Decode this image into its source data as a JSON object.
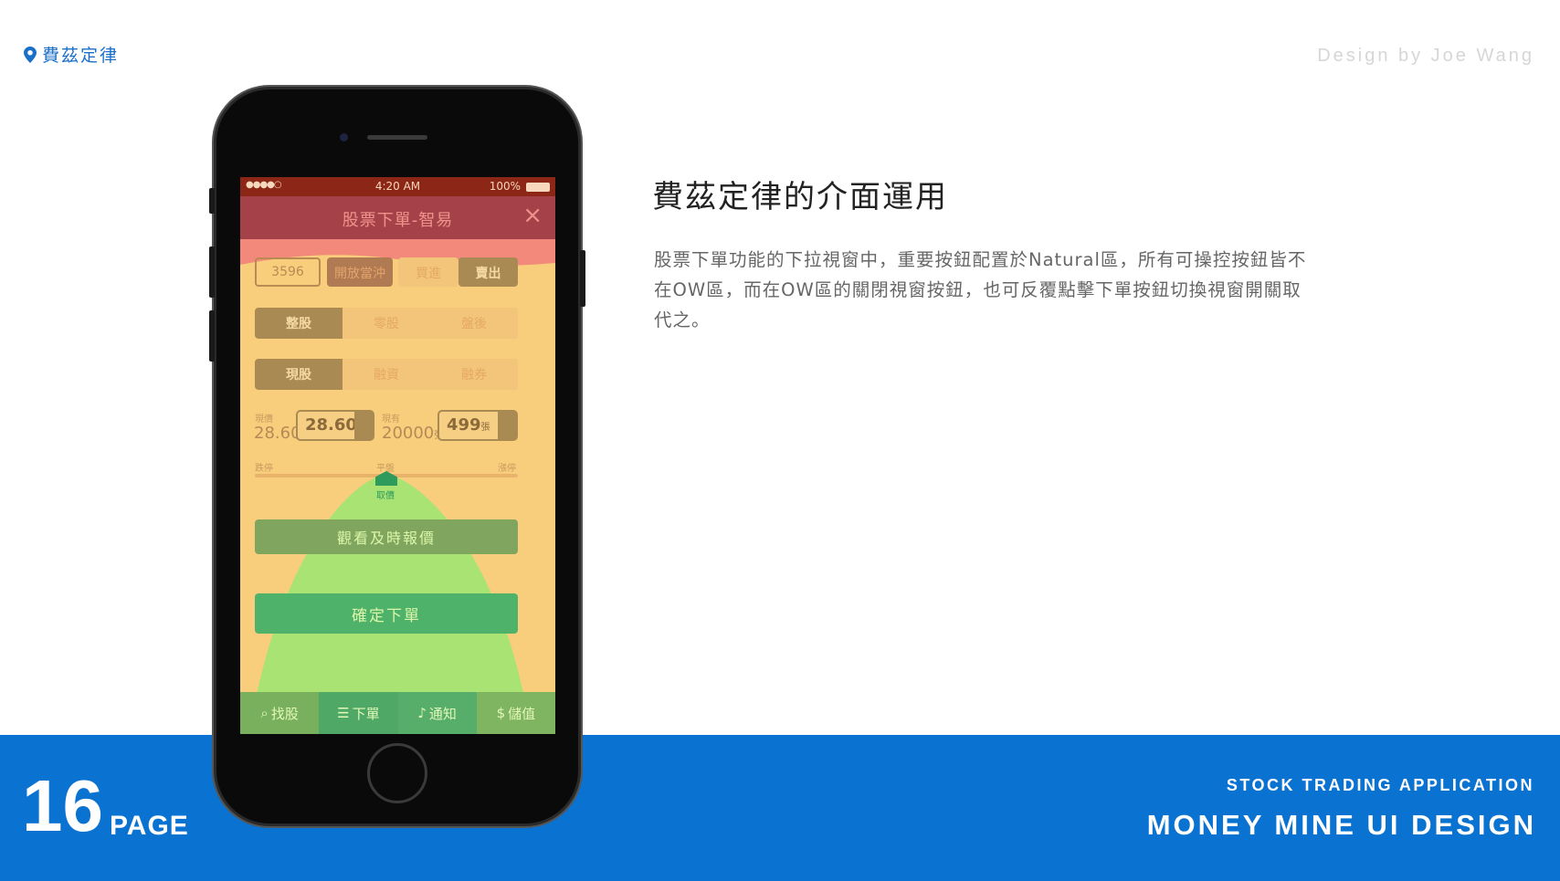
{
  "header": {
    "location_label": "費茲定律",
    "credit": "Design by Joe Wang"
  },
  "content": {
    "heading": "費茲定律的介面運用",
    "description": "股票下單功能的下拉視窗中，重要按鈕配置於Natural區，所有可操控按鈕皆不在OW區，而在OW區的關閉視窗按鈕，也可反覆點擊下單按鈕切換視窗開關取代之。"
  },
  "footer": {
    "page_number": "16",
    "page_label": "PAGE",
    "subtitle": "STOCK TRADING APPLICATION",
    "title": "MONEY MINE UI DESIGN"
  },
  "phone": {
    "status": {
      "signal": "●●●●○",
      "time": "4:20 AM",
      "battery": "100%"
    },
    "title": "股票下單-智易",
    "close_icon": "close-icon",
    "stock_code": "3596",
    "order_buttons": [
      "開放當沖",
      "買進",
      "賣出"
    ],
    "lot_types": [
      "整股",
      "零股",
      "盤後"
    ],
    "trade_types": [
      "現股",
      "融資",
      "融券"
    ],
    "price": {
      "label": "現價",
      "current": "28.60",
      "input": "28.60"
    },
    "holding": {
      "label": "現有",
      "value": "20000",
      "unit": "張",
      "input": "499",
      "input_unit": "張"
    },
    "slider": {
      "left": "跌停",
      "center": "平盤",
      "right": "漲停",
      "marker": "取價"
    },
    "quote_button": "觀看及時報價",
    "confirm_button": "確定下單",
    "tabs": [
      {
        "label": "找股",
        "icon": "search-icon"
      },
      {
        "label": "下單",
        "icon": "order-icon"
      },
      {
        "label": "通知",
        "icon": "bell-icon"
      },
      {
        "label": "儲值",
        "icon": "dollar-icon"
      }
    ],
    "zone_colors": {
      "ow": "#f2897a",
      "stretch": "#f8ce7d",
      "natural": "#7bd86a"
    }
  }
}
